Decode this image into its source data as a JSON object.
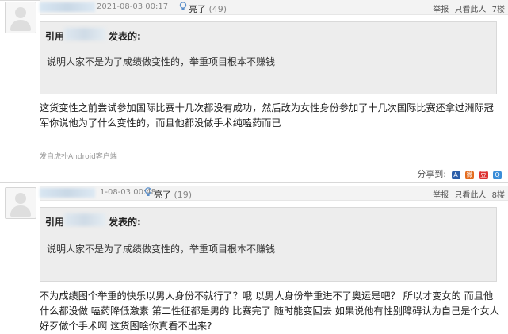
{
  "posts": [
    {
      "date": "2021-08-03 00:17",
      "light_label": "亮了",
      "light_count": "(49)",
      "report": "举报",
      "only_this": "只看此人",
      "floor": "7楼",
      "quote_prefix": "引用",
      "quote_suffix": "发表的:",
      "quote_text": "说明人家不是为了成绩做变性的，举重项目根本不赚钱",
      "content": "这货变性之前尝试参加国际比赛十几次都没有成功，然后改为女性身份参加了十几次国际比赛还拿过洲际冠军你说他为了什么变性的，而且他都没做手术纯嗑药而已",
      "source": "发自虎扑Android客户端",
      "share_label": "分享到:"
    },
    {
      "date": "1-08-03 00:48",
      "light_label": "亮了",
      "light_count": "(19)",
      "report": "举报",
      "only_this": "只看此人",
      "floor": "8楼",
      "quote_prefix": "引用",
      "quote_suffix": "发表的:",
      "quote_text": "说明人家不是为了成绩做变性的，举重项目根本不赚钱",
      "content": "不为成绩图个举重的快乐以男人身份不就行了？哦 以男人身份举重进不了奥运是吧？ 所以才变女的 而且他什么都没做 嗑药降低激素 第二性征都是男的 比赛完了 随时能变回去 如果说他有性别障碍认为自己是个女人好歹做个手术啊 这货图啥你真看不出来?"
    }
  ],
  "colors": {
    "link": "#1a5aa0",
    "quote_bg": "#ededed",
    "light": "#5a8ec9"
  }
}
